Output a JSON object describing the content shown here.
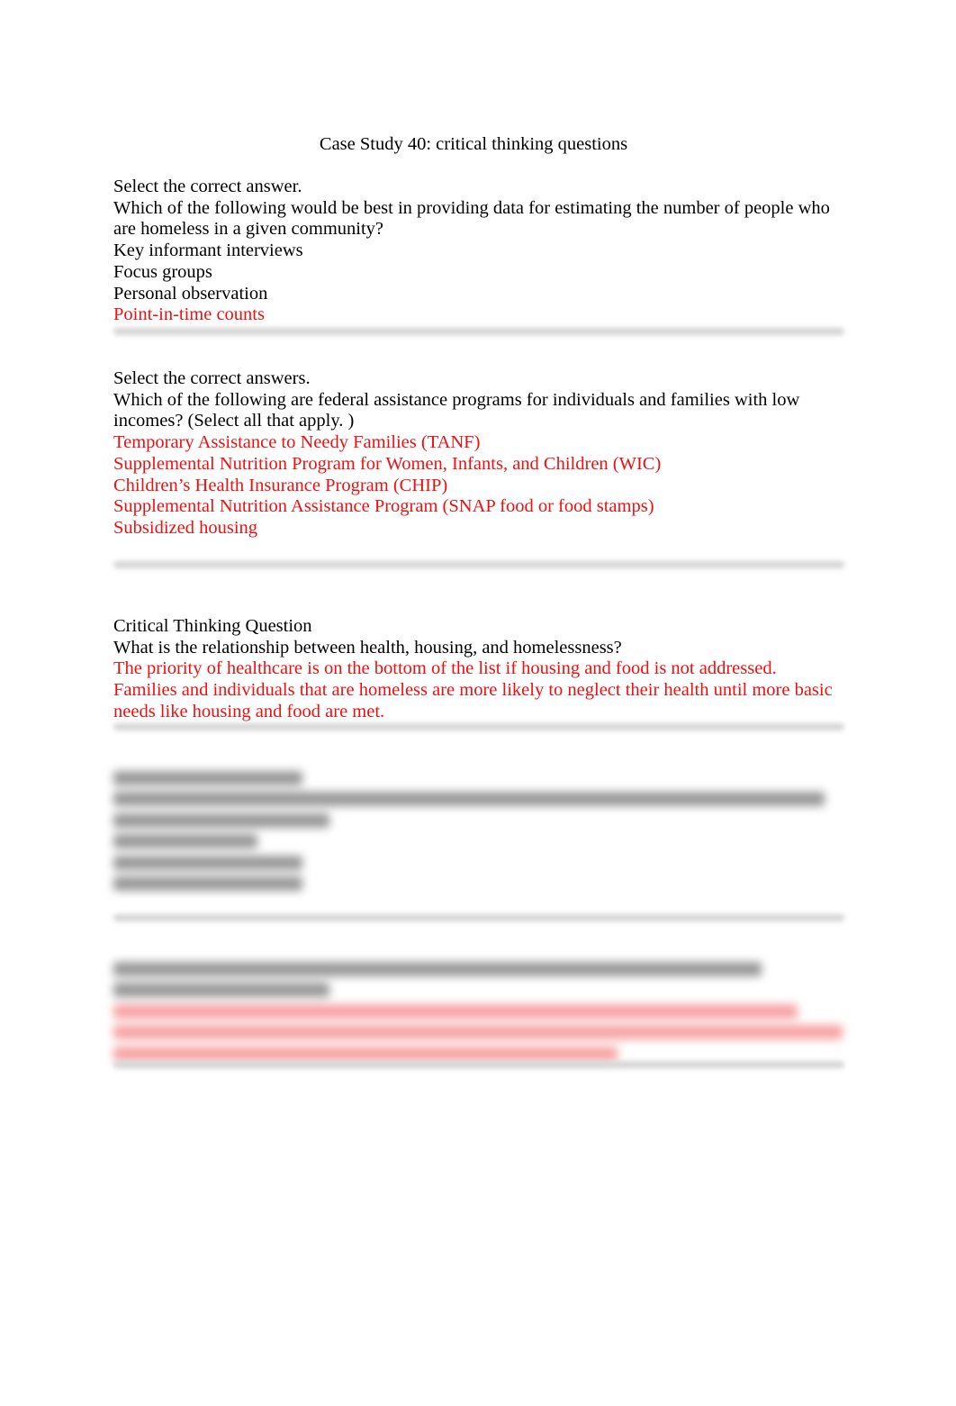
{
  "document": {
    "title": "Case Study 40: critical thinking questions",
    "colors": {
      "answer": "#ee1111",
      "text": "#000000",
      "separator": "#d4d4d4"
    },
    "q1": {
      "instruction": "Select the correct answer.",
      "question": "Which of the following would be best in providing data for estimating the number of people who are homeless in a given community?",
      "options": [
        "Key informant interviews",
        "Focus groups",
        "Personal observation"
      ],
      "answer": "Point-in-time counts"
    },
    "q2": {
      "instruction": "Select the correct answers.",
      "question": "Which of the following are federal assistance programs for individuals and families with low incomes? (Select all that apply. )",
      "answers": [
        "Temporary Assistance to Needy Families (TANF)",
        "Supplemental Nutrition Program for Women, Infants, and Children (WIC)",
        "Children’s Health Insurance Program (CHIP)",
        "Supplemental Nutrition Assistance Program (SNAP food or food stamps)",
        "Subsidized housing"
      ]
    },
    "q3": {
      "heading": "Critical Thinking Question",
      "question": "What is the relationship between health, housing, and homelessness?",
      "answer_1": "The priority of healthcare is on the bottom of the list if housing and food is not addressed.",
      "answer_2": "Families and individuals that are homeless are more likely to neglect their health until more basic needs like housing and food are met."
    }
  }
}
